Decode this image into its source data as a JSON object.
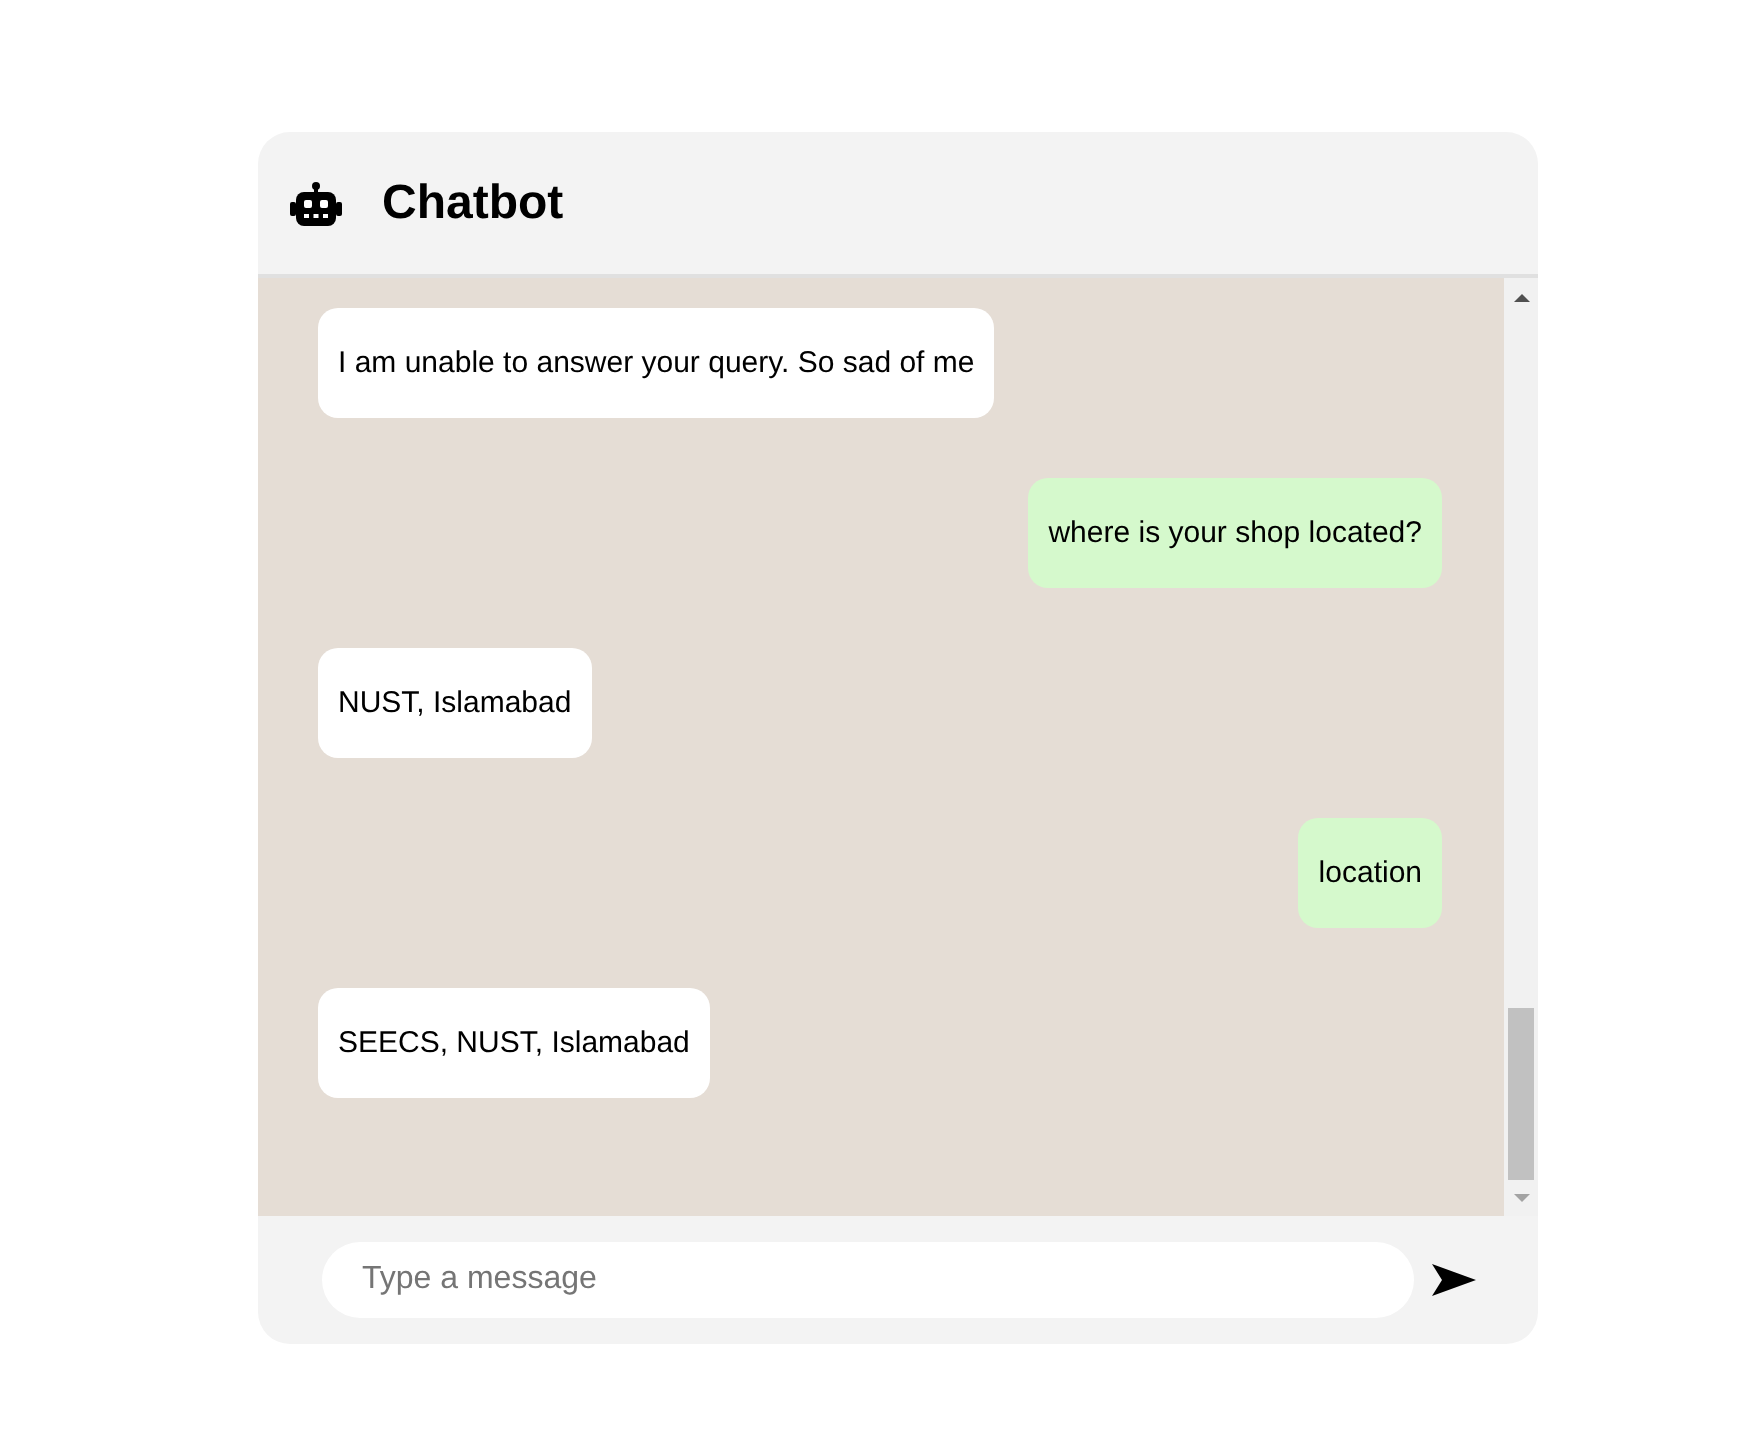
{
  "header": {
    "title": "Chatbot"
  },
  "messages": [
    {
      "kind": "bot",
      "text": "I am unable to answer your query. So sad of me"
    },
    {
      "kind": "user",
      "text": "where is your shop located?"
    },
    {
      "kind": "bot",
      "text": "NUST, Islamabad"
    },
    {
      "kind": "user",
      "text": "location"
    },
    {
      "kind": "bot",
      "text": "SEECS, NUST, Islamabad"
    }
  ],
  "composer": {
    "placeholder": "Type a message"
  }
}
